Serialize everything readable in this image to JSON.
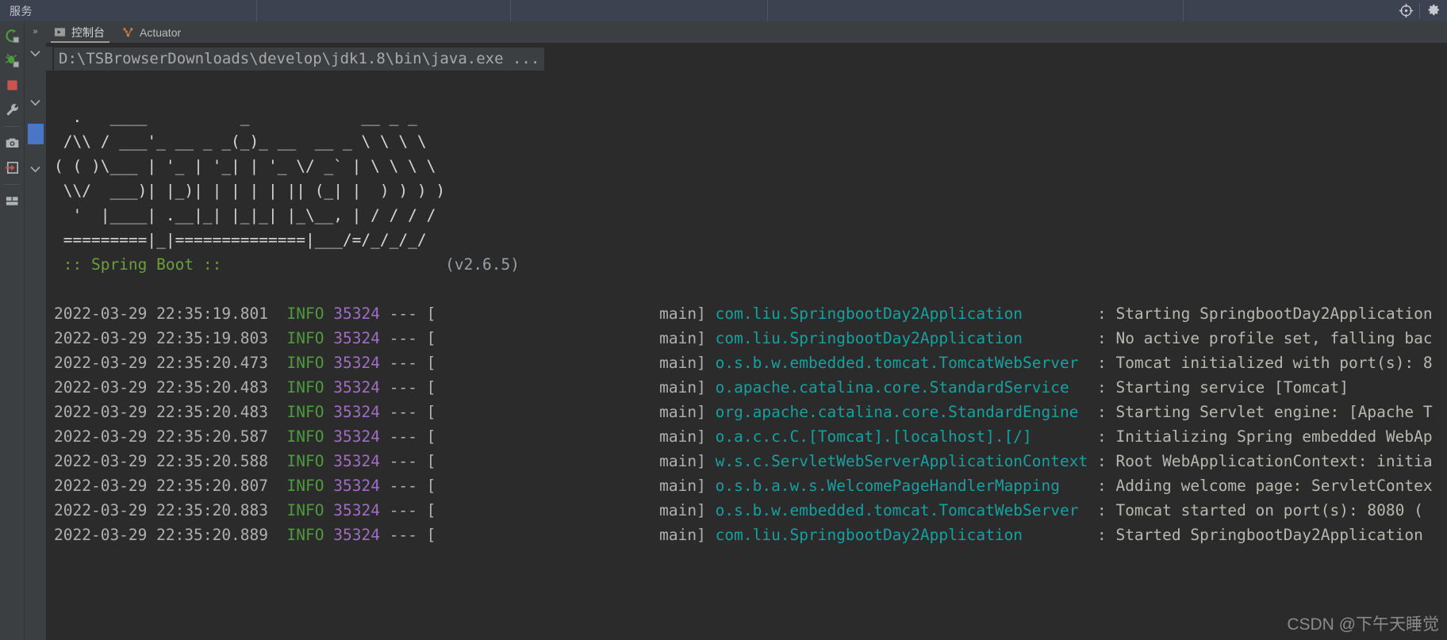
{
  "window": {
    "title": "服务",
    "header_icons": [
      {
        "name": "locate-icon",
        "glyph": "locate"
      },
      {
        "name": "settings-gear-icon",
        "glyph": "gear"
      }
    ]
  },
  "left_toolbar": {
    "items": [
      {
        "name": "rerun-icon",
        "label": "Rerun"
      },
      {
        "name": "debug-icon",
        "label": "Debug"
      },
      {
        "name": "stop-icon",
        "label": "Stop"
      },
      {
        "name": "wrench-icon",
        "label": "Settings"
      },
      {
        "name": "camera-icon",
        "label": "Snapshot"
      },
      {
        "name": "exit-icon",
        "label": "Exit"
      },
      {
        "name": "layout-icon",
        "label": "Layout"
      }
    ]
  },
  "chevron_rail": {
    "expand_label": "»"
  },
  "tabs": [
    {
      "id": "console",
      "label": "控制台",
      "icon": "console-icon",
      "active": true
    },
    {
      "id": "actuator",
      "label": "Actuator",
      "icon": "actuator-icon",
      "active": false
    }
  ],
  "console": {
    "command_line": "D:\\TSBrowserDownloads\\develop\\jdk1.8\\bin\\java.exe ...",
    "banner": [
      "  .   ____          _            __ _ _",
      " /\\\\ / ___'_ __ _ _(_)_ __  __ _ \\ \\ \\ \\",
      "( ( )\\___ | '_ | '_| | '_ \\/ _` | \\ \\ \\ \\",
      " \\\\/  ___)| |_)| | | | | || (_| |  ) ) ) )",
      "  '  |____| .__|_| |_|_| |_\\__, | / / / /",
      " =========|_|==============|___/=/_/_/_/"
    ],
    "banner_footer": {
      "name": ":: Spring Boot ::",
      "version": "(v2.6.5)",
      "name_color": "#6a9e3f",
      "version_color": "#9aa0a6"
    },
    "log_columns": [
      "timestamp",
      "level",
      "pid",
      "sep",
      "thread",
      "logger",
      "colon",
      "message"
    ],
    "log_lines": [
      {
        "timestamp": "2022-03-29 22:35:19.801",
        "level": "INFO",
        "pid": "35324",
        "sep": "---",
        "thread": "main",
        "logger": "com.liu.SpringbootDay2Application",
        "message": "Starting SpringbootDay2Application"
      },
      {
        "timestamp": "2022-03-29 22:35:19.803",
        "level": "INFO",
        "pid": "35324",
        "sep": "---",
        "thread": "main",
        "logger": "com.liu.SpringbootDay2Application",
        "message": "No active profile set, falling bac"
      },
      {
        "timestamp": "2022-03-29 22:35:20.473",
        "level": "INFO",
        "pid": "35324",
        "sep": "---",
        "thread": "main",
        "logger": "o.s.b.w.embedded.tomcat.TomcatWebServer",
        "message": "Tomcat initialized with port(s): 8"
      },
      {
        "timestamp": "2022-03-29 22:35:20.483",
        "level": "INFO",
        "pid": "35324",
        "sep": "---",
        "thread": "main",
        "logger": "o.apache.catalina.core.StandardService",
        "message": "Starting service [Tomcat]"
      },
      {
        "timestamp": "2022-03-29 22:35:20.483",
        "level": "INFO",
        "pid": "35324",
        "sep": "---",
        "thread": "main",
        "logger": "org.apache.catalina.core.StandardEngine",
        "message": "Starting Servlet engine: [Apache T"
      },
      {
        "timestamp": "2022-03-29 22:35:20.587",
        "level": "INFO",
        "pid": "35324",
        "sep": "---",
        "thread": "main",
        "logger": "o.a.c.c.C.[Tomcat].[localhost].[/]",
        "message": "Initializing Spring embedded WebAp"
      },
      {
        "timestamp": "2022-03-29 22:35:20.588",
        "level": "INFO",
        "pid": "35324",
        "sep": "---",
        "thread": "main",
        "logger": "w.s.c.ServletWebServerApplicationContext",
        "message": "Root WebApplicationContext: initia"
      },
      {
        "timestamp": "2022-03-29 22:35:20.807",
        "level": "INFO",
        "pid": "35324",
        "sep": "---",
        "thread": "main",
        "logger": "o.s.b.a.w.s.WelcomePageHandlerMapping",
        "message": "Adding welcome page: ServletContex"
      },
      {
        "timestamp": "2022-03-29 22:35:20.883",
        "level": "INFO",
        "pid": "35324",
        "sep": "---",
        "thread": "main",
        "logger": "o.s.b.w.embedded.tomcat.TomcatWebServer",
        "message": "Tomcat started on port(s): 8080 ("
      },
      {
        "timestamp": "2022-03-29 22:35:20.889",
        "level": "INFO",
        "pid": "35324",
        "sep": "---",
        "thread": "main",
        "logger": "com.liu.SpringbootDay2Application",
        "message": "Started SpringbootDay2Application"
      }
    ]
  },
  "watermark": {
    "text": "CSDN @下午天睡觉"
  },
  "colors": {
    "background": "#2b2b2b",
    "titlebar": "#3c4250",
    "toolbar": "#3c3f41",
    "info_green": "#4e9a3e",
    "pid_purple": "#a06cc4",
    "logger_cyan": "#17a0a0",
    "selection_blue": "#4a76c7"
  }
}
